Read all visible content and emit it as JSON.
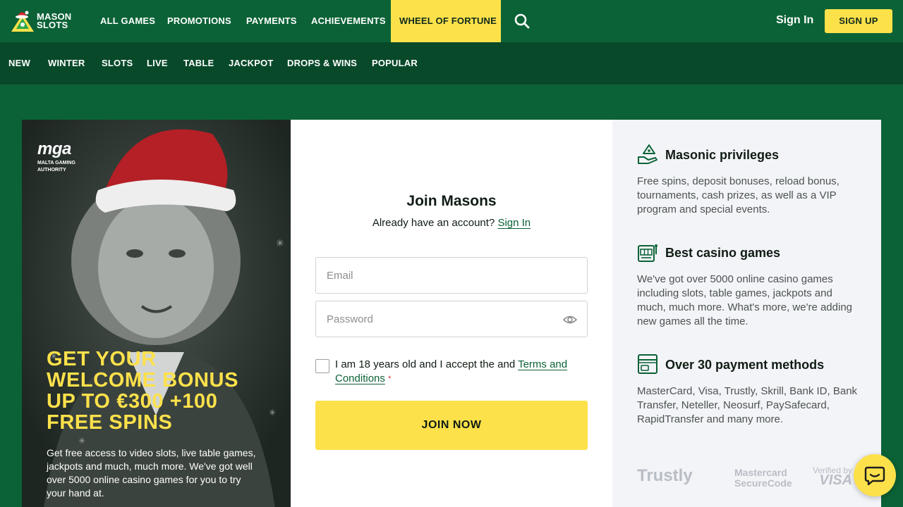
{
  "brand": {
    "line1": "MASON",
    "line2": "SLOTS"
  },
  "topnav": {
    "items": [
      "ALL GAMES",
      "PROMOTIONS",
      "PAYMENTS",
      "ACHIEVEMENTS",
      "WHEEL OF FORTUNE"
    ],
    "active": "WHEEL OF FORTUNE",
    "signin": "Sign In",
    "signup": "SIGN UP"
  },
  "subnav": {
    "items": [
      "NEW",
      "WINTER",
      "SLOTS",
      "LIVE",
      "TABLE",
      "JACKPOT",
      "DROPS & WINS",
      "POPULAR"
    ]
  },
  "promo": {
    "mga_big": "mga",
    "mga_small1": "MALTA GAMING",
    "mga_small2": "AUTHORITY",
    "headline": "GET YOUR WELCOME BONUS UP TO €300 +100 FREE SPINS",
    "text": "Get free access to video slots, live table games, jackpots and much, much more. We've got well over 5000 online casino games for you to try your hand at."
  },
  "form": {
    "title": "Join Masons",
    "already": "Already have an account?",
    "signin_link": "Sign In",
    "email_placeholder": "Email",
    "password_placeholder": "Password",
    "terms_prefix": "I am 18 years old and I accept the and",
    "terms_link": "Terms and Conditions",
    "required_mark": "*",
    "join": "JOIN NOW"
  },
  "features": [
    {
      "icon": "hand-coin-icon",
      "title": "Masonic privileges",
      "desc": "Free spins, deposit bonuses, reload bonus, tournaments, cash prizes, as well as a VIP program and special events."
    },
    {
      "icon": "slot-machine-icon",
      "title": "Best casino games",
      "desc": "We've got over 5000 online casino games including slots, table games, jackpots and much, much more. What's more, we're adding new games all the time."
    },
    {
      "icon": "wallet-card-icon",
      "title": "Over 30 payment methods",
      "desc": "MasterCard, Visa, Trustly, Skrill, Bank ID, Bank Transfer, Neteller, Neosurf, PaySafecard, RapidTransfer and many more."
    }
  ],
  "payment_logos": {
    "trustly": "Trustly",
    "mc1": "Mastercard",
    "mc2": "SecureCode",
    "visa1": "Verified by",
    "visa2": "VISA"
  },
  "colors": {
    "primary_green": "#0b6236",
    "dark_green": "#08492a",
    "accent_yellow": "#fde14b"
  }
}
